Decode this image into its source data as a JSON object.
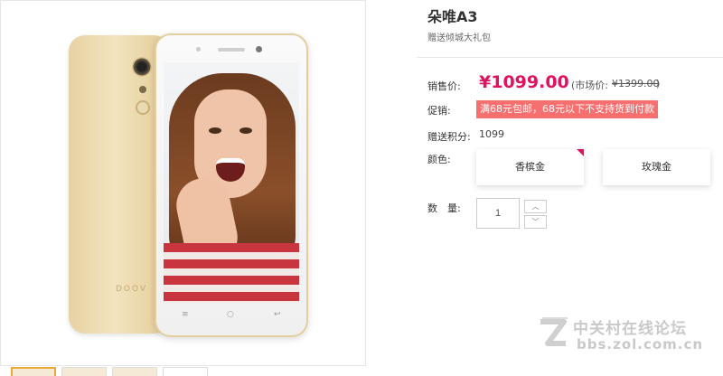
{
  "product": {
    "title": "朵唯A3",
    "subtitle": "赠送倾城大礼包"
  },
  "price": {
    "label": "销售价:",
    "current": "¥1099.00",
    "market_label": "(市场价:",
    "market_value": "¥1399.00",
    "market_close": ")"
  },
  "promo": {
    "label": "促销:",
    "text": "满68元包邮，68元以下不支持货到付款"
  },
  "points": {
    "label": "赠送积分:",
    "value": "1099"
  },
  "color": {
    "label": "颜色:",
    "options": [
      {
        "label": "香槟金",
        "selected": true
      },
      {
        "label": "玫瑰金",
        "selected": false
      }
    ]
  },
  "quantity": {
    "label": "数　量:",
    "value": "1",
    "up_icon": "chevron-up-icon",
    "down_icon": "chevron-down-icon"
  },
  "gallery": {
    "phone_back_logo": "DOOV",
    "thumbnails": 4
  },
  "watermark": {
    "text": "中关村在线论坛",
    "url": "bbs.zol.com.cn"
  },
  "colors": {
    "accent": "#e0115f",
    "promo_bg": "#f76f6f",
    "gold": "#e6d2a2"
  }
}
